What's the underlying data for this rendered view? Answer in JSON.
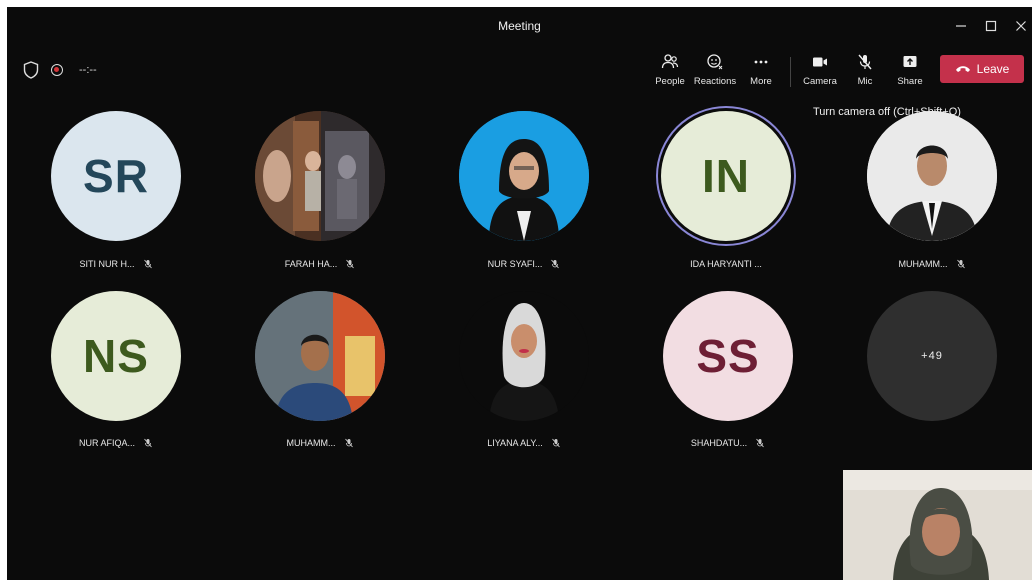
{
  "window": {
    "title": "Meeting",
    "controls": [
      "minimize-icon",
      "maximize-icon",
      "close-icon"
    ]
  },
  "status": {
    "timer": "--:--"
  },
  "toolbar": {
    "people_label": "People",
    "reactions_label": "Reactions",
    "more_label": "More",
    "camera_label": "Camera",
    "mic_label": "Mic",
    "share_label": "Share",
    "leave_label": "Leave"
  },
  "tooltip": {
    "text": "Turn camera off (Ctrl+Shift+O)"
  },
  "participants": [
    {
      "name": "SITI NUR H...",
      "initials": "SR",
      "avatar_bg": "#dbe6ee",
      "initials_color": "#24475a"
    },
    {
      "name": "FARAH HA...",
      "photo": true
    },
    {
      "name": "NUR SYAFI...",
      "photo": true
    },
    {
      "name": "IDA HARYANTI ...",
      "initials": "IN",
      "avatar_bg": "#e6ecd8",
      "initials_color": "#3d5a1e",
      "speaking": true
    },
    {
      "name": "MUHAMM...",
      "photo": true
    },
    {
      "name": "NUR AFIQA...",
      "initials": "NS",
      "avatar_bg": "#e6ecd8",
      "initials_color": "#3d5a1e"
    },
    {
      "name": "MUHAMM...",
      "photo": true
    },
    {
      "name": "LIYANA ALY...",
      "photo": true
    },
    {
      "name": "SHAHDATU...",
      "initials": "SS",
      "avatar_bg": "#f2dde2",
      "initials_color": "#6e1f35"
    }
  ],
  "overflow": {
    "label": "+49"
  },
  "colors": {
    "leave": "#c4314b",
    "background": "#0b0b0b",
    "speaking_ring": "#8a87d6"
  }
}
